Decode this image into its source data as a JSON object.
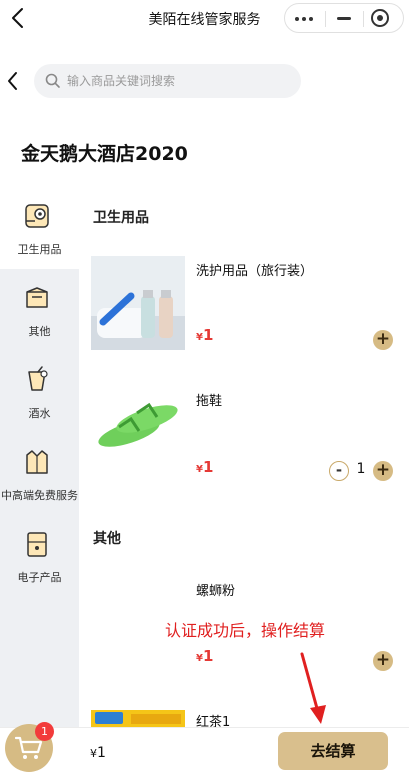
{
  "header": {
    "title": "美陌在线管家服务"
  },
  "search": {
    "placeholder": "输入商品关键词搜索"
  },
  "shop": {
    "name": "金天鹅大酒店2020"
  },
  "sidebar": {
    "items": [
      {
        "label": "卫生用品",
        "icon": "toilet-paper-icon",
        "active": true
      },
      {
        "label": "其他",
        "icon": "box-icon",
        "active": false
      },
      {
        "label": "酒水",
        "icon": "drink-icon",
        "active": false
      },
      {
        "label": "中高端免费服务",
        "icon": "shirt-icon",
        "active": false
      },
      {
        "label": "电子产品",
        "icon": "device-icon",
        "active": false
      }
    ]
  },
  "sections": [
    {
      "title": "卫生用品",
      "products": [
        {
          "name": "洗护用品（旅行装）",
          "currency": "¥",
          "price": "1",
          "image": "toiletries-image",
          "quantity": null
        },
        {
          "name": "拖鞋",
          "currency": "¥",
          "price": "1",
          "image": "slippers-image",
          "quantity": "1"
        }
      ]
    },
    {
      "title": "其他",
      "products": [
        {
          "name": "螺蛳粉",
          "currency": "¥",
          "price": "1",
          "image": null,
          "quantity": null
        },
        {
          "name": "红茶1",
          "currency": "¥",
          "price": "1",
          "image": "black-tea-image",
          "quantity": null
        }
      ]
    }
  ],
  "annotation": "认证成功后，操作结算",
  "cart": {
    "badge": "1",
    "currency": "¥",
    "total": "1",
    "checkout_label": "去结算"
  },
  "colors": {
    "accent": "#d6bb84",
    "price": "#e53935",
    "badge": "#f23b3b",
    "annotation": "#e02020"
  }
}
